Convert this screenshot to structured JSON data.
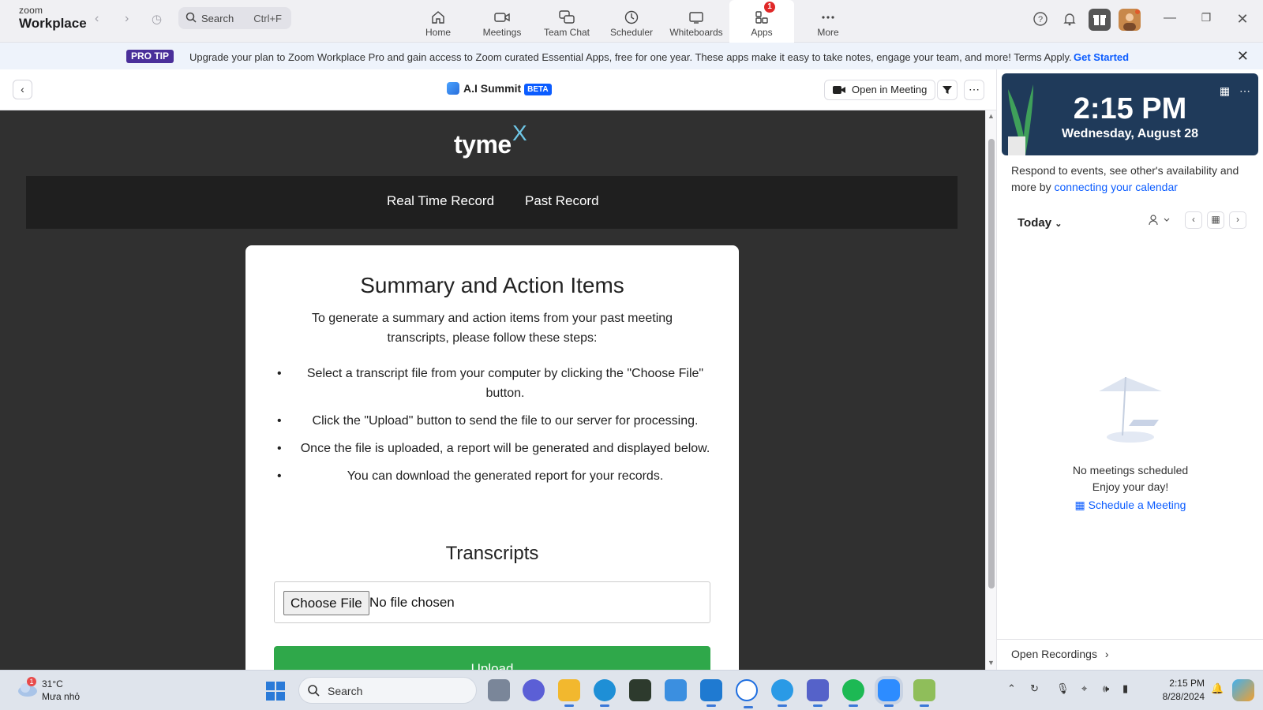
{
  "window": {
    "brand_small": "zoom",
    "brand_large": "Workplace",
    "search_label": "Search",
    "search_shortcut": "Ctrl+F"
  },
  "nav": {
    "tabs": [
      {
        "label": "Home",
        "icon": "home-icon"
      },
      {
        "label": "Meetings",
        "icon": "video-icon"
      },
      {
        "label": "Team Chat",
        "icon": "chat-icon"
      },
      {
        "label": "Scheduler",
        "icon": "clock-icon"
      },
      {
        "label": "Whiteboards",
        "icon": "whiteboard-icon"
      },
      {
        "label": "Apps",
        "icon": "apps-icon",
        "active": true,
        "badge": "1"
      },
      {
        "label": "More",
        "icon": "more-icon"
      }
    ]
  },
  "protip": {
    "tag": "PRO TIP",
    "message": "Upgrade your plan to Zoom Workplace Pro and gain access to Zoom curated Essential Apps, free for one year. These apps make it easy to take notes, engage your team, and more! Terms Apply.",
    "cta": "Get Started"
  },
  "app_header": {
    "title": "A.I Summit",
    "beta": "BETA",
    "open_in_meeting": "Open in Meeting"
  },
  "app": {
    "logo": "tyme",
    "logo_mark": "X",
    "tabs": [
      "Real Time Record",
      "Past Record"
    ],
    "card": {
      "title": "Summary and Action Items",
      "intro": "To generate a summary and action items from your past meeting transcripts, please follow these steps:",
      "steps": [
        "Select a transcript file from your computer by clicking the \"Choose File\" button.",
        "Click the \"Upload\" button to send the file to our server for processing.",
        "Once the file is uploaded, a report will be generated and displayed below.",
        "You can download the generated report for your records."
      ],
      "section_title": "Transcripts",
      "choose_file": "Choose File",
      "no_file": "No file chosen",
      "upload": "Upload"
    }
  },
  "calendar": {
    "time": "2:15 PM",
    "date": "Wednesday, August 28",
    "respond_prefix": "Respond to events, see other's availability and more by ",
    "respond_link": "connecting your calendar",
    "today": "Today",
    "no_meetings": "No meetings scheduled",
    "enjoy": "Enjoy your day!",
    "schedule": "Schedule a Meeting",
    "open_recordings": "Open Recordings"
  },
  "taskbar": {
    "weather_badge": "1",
    "temperature": "31°C",
    "condition": "Mưa nhỏ",
    "search": "Search",
    "clock_time": "2:15 PM",
    "clock_date": "8/28/2024"
  },
  "colors": {
    "accent": "#0b5cff",
    "upload_green": "#2fa84a",
    "app_bg": "#303030",
    "calendar_card": "#1f3a5a"
  }
}
